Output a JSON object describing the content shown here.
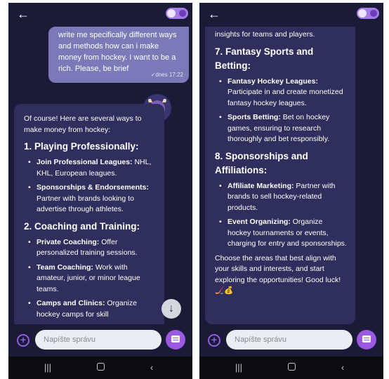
{
  "left_screen": {
    "user_message": "write me specifically different ways and methods how can i make money from hockey. I want to be a rich. Please, be brief",
    "user_meta": "✓dnes 17:22",
    "intro": "Of course! Here are several ways to make money from hockey:",
    "sections": [
      {
        "heading": "1. Playing Professionally:",
        "items": [
          {
            "term": "Join Professional Leagues:",
            "text": " NHL, KHL, European leagues."
          },
          {
            "term": "Sponsorships & Endorsements:",
            "text": " Partner with brands looking to advertise through athletes."
          }
        ]
      },
      {
        "heading": "2. Coaching and Training:",
        "items": [
          {
            "term": "Private Coaching:",
            "text": " Offer personalized training sessions."
          },
          {
            "term": "Team Coaching:",
            "text": " Work with amateur, junior, or minor league teams."
          },
          {
            "term": "Camps and Clinics:",
            "text": " Organize hockey camps for skill"
          }
        ]
      }
    ]
  },
  "right_screen": {
    "top_fragment": "insights for teams and players.",
    "sections": [
      {
        "heading": "7. Fantasy Sports and Betting:",
        "items": [
          {
            "term": "Fantasy Hockey Leagues:",
            "text": " Participate in and create monetized fantasy hockey leagues."
          },
          {
            "term": "Sports Betting:",
            "text": " Bet on hockey games, ensuring to research thoroughly and bet responsibly."
          }
        ]
      },
      {
        "heading": "8. Sponsorships and Affiliations:",
        "items": [
          {
            "term": "Affiliate Marketing:",
            "text": " Partner with brands to sell hockey-related products."
          },
          {
            "term": "Event Organizing:",
            "text": " Organize hockey tournaments or events, charging for entry and sponsorships."
          }
        ]
      }
    ],
    "closing": "Choose the areas that best align with your skills and interests, and start exploring the opportunities! Good luck! 🏒💰"
  },
  "input": {
    "placeholder": "Napíšte správu"
  },
  "icons": {
    "back": "arrow-left-icon",
    "theme": "theme-toggle-icon",
    "scroll": "arrow-down-icon",
    "add": "plus-circle-icon",
    "send": "message-send-icon",
    "nav_recent": "recent-apps-icon",
    "nav_home": "home-icon",
    "nav_back": "chevron-left-icon"
  },
  "glyphs": {
    "back": "←",
    "scroll": "↓",
    "add": "+",
    "nav_recent": "|||",
    "nav_back": "‹"
  },
  "colors": {
    "background": "#1b1b38",
    "bot_bubble": "#2f2e5c",
    "user_bubble": "#7c79b8",
    "accent": "#9b59e0"
  }
}
